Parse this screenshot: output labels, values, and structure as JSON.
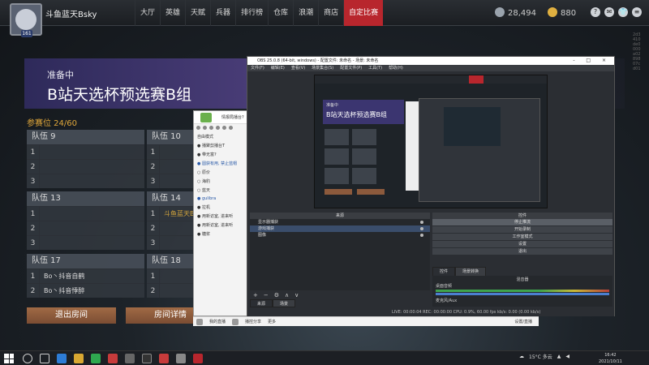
{
  "game": {
    "player_name": "斗鱼蓝天Bsky",
    "level": "161",
    "nav": [
      "大厅",
      "英雄",
      "天赋",
      "兵器",
      "排行榜",
      "仓库",
      "浪潮",
      "商店",
      "自定比赛"
    ],
    "active_nav": "自定比赛",
    "currency_a": "28,494",
    "currency_b": "880",
    "sys_icons": [
      "?",
      "✉",
      "👕",
      "≡"
    ],
    "match": {
      "status": "准备中",
      "title": "B站天选杯预选赛B组",
      "slots": "参赛位 24/60",
      "teams": [
        {
          "name": "队伍 9",
          "members": [
            "",
            "",
            ""
          ]
        },
        {
          "name": "队伍 10",
          "members": [
            "",
            "",
            ""
          ]
        },
        {
          "name": "队伍 13",
          "members": [
            "",
            "",
            ""
          ]
        },
        {
          "name": "队伍 14",
          "members": [
            "斗鱼蓝天Bs",
            "",
            ""
          ]
        },
        {
          "name": "队伍 17",
          "members": [
            "Bo丶抖音自鹤",
            "Bo丶抖音悸醉"
          ]
        },
        {
          "name": "队伍 18",
          "members": [
            "",
            ""
          ]
        }
      ],
      "exit_button": "退出房间",
      "detail_button": "房间详情"
    },
    "side_text": "2d3410de0000a0289807cd01"
  },
  "chat": {
    "title": "情报局播台?",
    "lines": [
      "自由模式",
      "● 播聚剪播台T",
      "● 带无富?",
      "● 圆获有用, 禁止蓝帽",
      "○ 原价",
      "○ 海豹",
      "○ 蓝天",
      "● gulibra",
      "● 拉机",
      "● 用新访室, 进来听",
      "● 用新访室, 进来听",
      "● 糖浆"
    ],
    "bottom": [
      "我的直播",
      "播控分享",
      "更多"
    ],
    "bottom_right": "设置/直播"
  },
  "obs": {
    "title": "OBS 25.0.8 (64-bit, windows) - 配置文件: 未命名 - 场景: 未命名",
    "window_buttons": "- □ ×",
    "menu": [
      "文件(F)",
      "编辑(E)",
      "查看(V)",
      "场景集合(S)",
      "配置文件(P)",
      "工具(T)",
      "帮助(H)"
    ],
    "preview": {
      "status": "准备中",
      "title": "B站天选杯预选赛B组"
    },
    "sources_title": "来源",
    "sources": [
      "显示器捕获",
      "游戏捕获",
      "图像"
    ],
    "sources_toolbar": [
      "+",
      "−",
      "⚙",
      "∧",
      "∨"
    ],
    "source_tabs": [
      "来源",
      "场景"
    ],
    "controls_title": "控件",
    "controls": [
      "停止推流",
      "开始录制",
      "工作室模式",
      "设置",
      "退出"
    ],
    "control_tabs": [
      "控件",
      "场景转换"
    ],
    "mixer_title": "混音器",
    "mixer_tracks": [
      "桌面音频",
      "麦克风/Aux"
    ],
    "statusbar": "LIVE: 00:00:04   REC: 00:00:00   CPU: 0.9%, 60.00 fps   kb/s: 0.00 (0.00 kb/s)"
  },
  "taskbar": {
    "weather": "15°C 多云",
    "time": "16:42",
    "date": "2021/10/11"
  }
}
